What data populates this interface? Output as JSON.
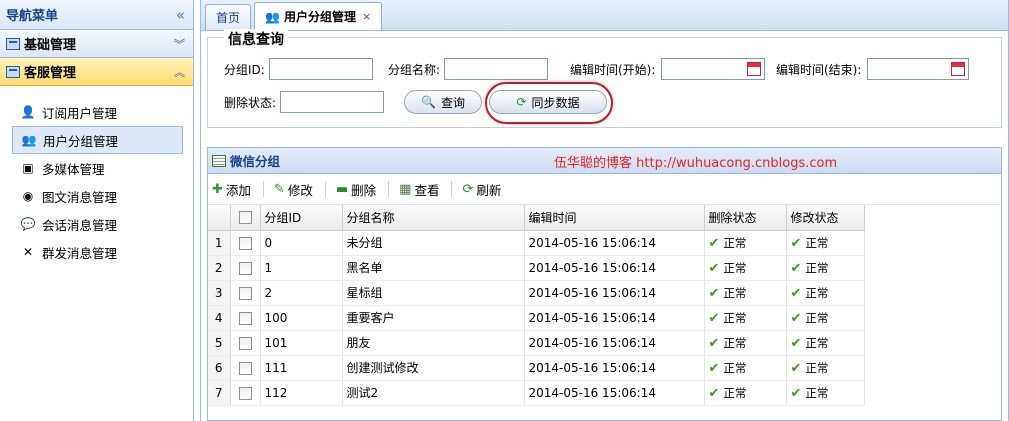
{
  "nav": {
    "title": "导航菜单",
    "sections": [
      {
        "label": "基础管理",
        "chevron": "︾"
      },
      {
        "label": "客服管理",
        "chevron": "︽"
      }
    ],
    "items": [
      {
        "label": "订阅用户管理",
        "icon": "user-icon"
      },
      {
        "label": "用户分组管理",
        "icon": "users-icon"
      },
      {
        "label": "多媒体管理",
        "icon": "image-icon"
      },
      {
        "label": "图文消息管理",
        "icon": "globe-icon"
      },
      {
        "label": "会话消息管理",
        "icon": "chat-icon"
      },
      {
        "label": "群发消息管理",
        "icon": "tools-icon"
      }
    ]
  },
  "tabs": [
    {
      "label": "首页"
    },
    {
      "label": "用户分组管理",
      "close": "×"
    }
  ],
  "query": {
    "legend": "信息查询",
    "group_id_label": "分组ID:",
    "group_name_label": "分组名称:",
    "edit_start_label": "编辑时间(开始):",
    "edit_end_label": "编辑时间(结束):",
    "delete_status_label": "删除状态:",
    "search_button": "查询",
    "sync_button": "同步数据"
  },
  "panel": {
    "title": "微信分组",
    "blog_note": "伍华聪的博客 http://wuhuacong.cnblogs.com",
    "toolbar": {
      "add": "添加",
      "edit": "修改",
      "delete": "删除",
      "view": "查看",
      "refresh": "刷新"
    },
    "columns": [
      "分组ID",
      "分组名称",
      "编辑时间",
      "删除状态",
      "修改状态"
    ],
    "rows": [
      {
        "n": "1",
        "id": "0",
        "name": "未分组",
        "time": "2014-05-16 15:06:14",
        "del": "正常",
        "mod": "正常"
      },
      {
        "n": "2",
        "id": "1",
        "name": "黑名单",
        "time": "2014-05-16 15:06:14",
        "del": "正常",
        "mod": "正常"
      },
      {
        "n": "3",
        "id": "2",
        "name": "星标组",
        "time": "2014-05-16 15:06:14",
        "del": "正常",
        "mod": "正常"
      },
      {
        "n": "4",
        "id": "100",
        "name": "重要客户",
        "time": "2014-05-16 15:06:14",
        "del": "正常",
        "mod": "正常"
      },
      {
        "n": "5",
        "id": "101",
        "name": "朋友",
        "time": "2014-05-16 15:06:14",
        "del": "正常",
        "mod": "正常"
      },
      {
        "n": "6",
        "id": "111",
        "name": "创建测试修改",
        "time": "2014-05-16 15:06:14",
        "del": "正常",
        "mod": "正常"
      },
      {
        "n": "7",
        "id": "112",
        "name": "测试2",
        "time": "2014-05-16 15:06:14",
        "del": "正常",
        "mod": "正常"
      }
    ]
  },
  "colors": {
    "accent": "#15428b",
    "border": "#99bbe8",
    "note": "#ee2222",
    "ring": "#b52424"
  }
}
